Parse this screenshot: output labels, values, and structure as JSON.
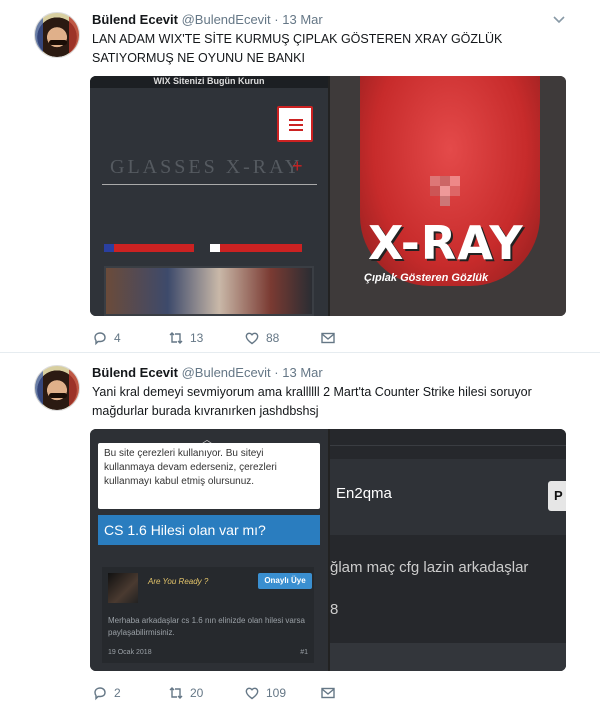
{
  "tweets": [
    {
      "name": "Bülend Ecevit",
      "handle": "@BulendEcevit",
      "time": "13 Mar",
      "text_line1": "LAN ADAM WIX'TE SİTE KURMUŞ ÇIPLAK GÖSTEREN XRAY GÖZLÜK",
      "text_line2": "SATIYORMUŞ NE OYUNU NE BANKI",
      "media_left": {
        "banner": "WIX Sitenizi Bugün Kurun",
        "title": "GLASSES  X-RAY",
        "plus": "+"
      },
      "media_right": {
        "big": "X-RAY",
        "sub": "Çıplak Gösteren Gözlük"
      },
      "replies": "4",
      "retweets": "13",
      "likes": "88"
    },
    {
      "name": "Bülend Ecevit",
      "handle": "@BulendEcevit",
      "time": "13 Mar",
      "text_line1": "Yani kral demeyi sevmiyorum ama krallllll 2 Mart'ta Counter Strike hilesi soruyor",
      "text_line2": "mağdurlar burada kıvranırken jashdbshsj",
      "media_left": {
        "cookie": "Bu site çerezleri kullanıyor. Bu siteyi kullanmaya devam ederseniz, çerezleri kullanmayı kabul etmiş olursunuz.",
        "question": "CS 1.6 Hilesi olan var mı?",
        "username": "Are You Ready ?",
        "badge": "Onaylı Üye",
        "message": "Merhaba arkadaşlar cs 1.6 nın elinizde olan hilesi varsa paylaşabilirmisiniz.",
        "date": "19 Ocak 2018",
        "post_number": "#1"
      },
      "media_right": {
        "username": "En2qma",
        "button": "P",
        "message": "ğlam maç cfg lazin arkadaşlar",
        "number": "8"
      },
      "replies": "2",
      "retweets": "20",
      "likes": "109"
    }
  ],
  "colors": {
    "thread_line": "#b3dbf3",
    "meta_gray": "#657786",
    "accent_blue": "#2a7dbf"
  },
  "icons": [
    "reply-icon",
    "retweet-icon",
    "like-icon",
    "message-icon",
    "chevron-down-icon"
  ]
}
